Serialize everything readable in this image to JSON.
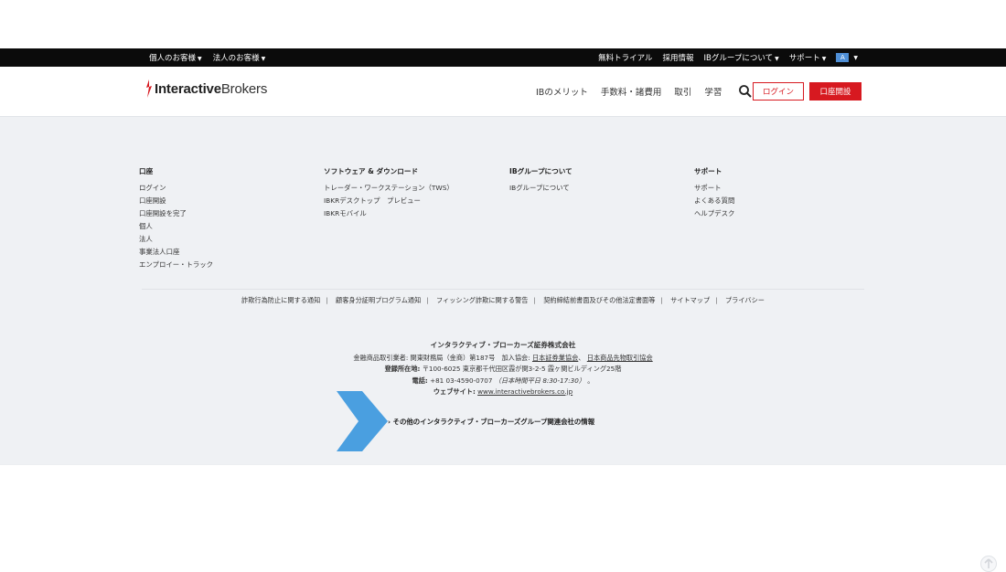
{
  "topbar": {
    "left": [
      "個人のお客様",
      "法人のお客様"
    ],
    "right": [
      "無料トライアル",
      "採用情報",
      "IBグループについて",
      "サポート"
    ],
    "lang_box": "A"
  },
  "header": {
    "logo_prefix": "Interactive",
    "logo_suffix": "Brokers",
    "nav": [
      "IBのメリット",
      "手数料・諸費用",
      "取引",
      "学習"
    ],
    "login": "ログイン",
    "open_account": "口座開設"
  },
  "footer": {
    "columns": [
      {
        "title": "口座",
        "items": [
          "ログイン",
          "口座開設",
          "口座開設を完了",
          "個人",
          "法人",
          "事業法人口座",
          "エンプロイー・トラック"
        ]
      },
      {
        "title": "ソフトウェア & ダウンロード",
        "items": [
          "トレーダー・ワークステーション（TWS）",
          "IBKRデスクトップ　プレビュー",
          "IBKRモバイル"
        ]
      },
      {
        "title": "IBグループについて",
        "items": [
          "IBグループについて"
        ]
      },
      {
        "title": "サポート",
        "items": [
          "サポート",
          "よくある質問",
          "ヘルプデスク"
        ]
      }
    ],
    "legal_links": [
      "詐欺行為防止に関する通知",
      "顧客身分証明プログラム通知",
      "フィッシング詐欺に関する警告",
      "契約締結前書面及びその他法定書面等",
      "サイトマップ",
      "プライバシー"
    ],
    "company": {
      "name": "インタラクティブ・ブローカーズ証券株式会社",
      "reg_prefix": "金融商品取引業者: 関東財務局（金商）第187号　加入協会:",
      "assoc1": "日本証券業協会",
      "assoc2": "日本商品先物取引協会",
      "address_label": "登録所在地:",
      "address": "〒100-6025 東京都千代田区霞が関3-2-5 霞ヶ関ビルディング25階",
      "phone_label": "電話:",
      "phone": "+81 03-4590-0707",
      "hours": "（日本時間平日 8:30-17:30）",
      "web_label": "ウェブサイト:",
      "web": "www.interactivebrokers.co.jp"
    },
    "group_link": "› その他のインタラクティブ・ブローカーズグループ関連会社の情報"
  },
  "colors": {
    "brand_red": "#d71920",
    "arrow_blue": "#4a9fe0"
  }
}
